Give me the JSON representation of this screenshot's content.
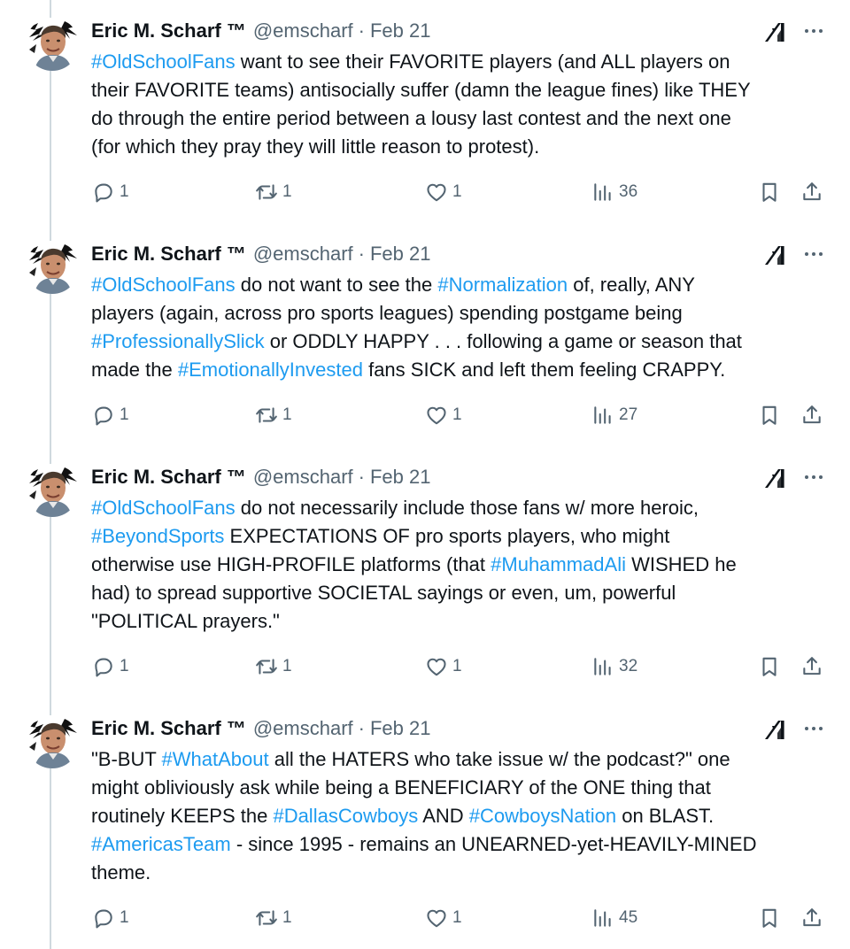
{
  "colors": {
    "text": "#0f1419",
    "muted": "#536471",
    "hashtag": "#1d9bf0",
    "thread_line": "#cfd9de"
  },
  "icons": [
    "avatar",
    "grok-icon",
    "more-icon",
    "reply-icon",
    "repost-icon",
    "like-icon",
    "views-icon",
    "bookmark-icon",
    "share-icon"
  ],
  "tweets": [
    {
      "author": {
        "name": "Eric M. Scharf ™",
        "handle": "@emscharf",
        "separator": "·",
        "date": "Feb 21"
      },
      "lines": [
        [
          {
            "t": "#OldSchoolFans",
            "h": true
          },
          {
            "t": " want to see their FAVORITE players (and ALL players on",
            "h": false
          }
        ],
        [
          {
            "t": "their FAVORITE teams) antisocially suffer (damn the league fines) like THEY",
            "h": false
          }
        ],
        [
          {
            "t": "do through the entire period between a lousy last contest and the next one",
            "h": false
          }
        ],
        [
          {
            "t": "(for which they pray they will little reason to protest).",
            "h": false
          }
        ]
      ],
      "stats": {
        "replies": "1",
        "reposts": "1",
        "likes": "1",
        "views": "36"
      }
    },
    {
      "author": {
        "name": "Eric M. Scharf ™",
        "handle": "@emscharf",
        "separator": "·",
        "date": "Feb 21"
      },
      "lines": [
        [
          {
            "t": "#OldSchoolFans",
            "h": true
          },
          {
            "t": " do not want to see the ",
            "h": false
          },
          {
            "t": "#Normalization",
            "h": true
          },
          {
            "t": " of, really, ANY",
            "h": false
          }
        ],
        [
          {
            "t": "players (again, across pro sports leagues) spending postgame being",
            "h": false
          }
        ],
        [
          {
            "t": "#ProfessionallySlick",
            "h": true
          },
          {
            "t": " or ODDLY HAPPY . . . following a game or season that",
            "h": false
          }
        ],
        [
          {
            "t": "made the ",
            "h": false
          },
          {
            "t": "#EmotionallyInvested",
            "h": true
          },
          {
            "t": " fans SICK and left them feeling CRAPPY.",
            "h": false
          }
        ]
      ],
      "stats": {
        "replies": "1",
        "reposts": "1",
        "likes": "1",
        "views": "27"
      }
    },
    {
      "author": {
        "name": "Eric M. Scharf ™",
        "handle": "@emscharf",
        "separator": "·",
        "date": "Feb 21"
      },
      "lines": [
        [
          {
            "t": "#OldSchoolFans",
            "h": true
          },
          {
            "t": " do not necessarily include those fans w/ more heroic,",
            "h": false
          }
        ],
        [
          {
            "t": "#BeyondSports",
            "h": true
          },
          {
            "t": " EXPECTATIONS OF pro sports players, who might",
            "h": false
          }
        ],
        [
          {
            "t": "otherwise use HIGH-PROFILE platforms (that ",
            "h": false
          },
          {
            "t": "#MuhammadAli",
            "h": true
          },
          {
            "t": " WISHED he",
            "h": false
          }
        ],
        [
          {
            "t": "had) to spread supportive SOCIETAL sayings or even, um, powerful",
            "h": false
          }
        ],
        [
          {
            "t": "\"POLITICAL prayers.\"",
            "h": false
          }
        ]
      ],
      "stats": {
        "replies": "1",
        "reposts": "1",
        "likes": "1",
        "views": "32"
      }
    },
    {
      "author": {
        "name": "Eric M. Scharf ™",
        "handle": "@emscharf",
        "separator": "·",
        "date": "Feb 21"
      },
      "lines": [
        [
          {
            "t": "\"B-BUT ",
            "h": false
          },
          {
            "t": "#WhatAbout",
            "h": true
          },
          {
            "t": " all the HATERS who take issue w/ the podcast?\" one",
            "h": false
          }
        ],
        [
          {
            "t": "might obliviously ask while being a BENEFICIARY of the ONE thing that",
            "h": false
          }
        ],
        [
          {
            "t": "routinely KEEPS the ",
            "h": false
          },
          {
            "t": "#DallasCowboys",
            "h": true
          },
          {
            "t": " AND ",
            "h": false
          },
          {
            "t": "#CowboysNation",
            "h": true
          },
          {
            "t": " on BLAST.",
            "h": false
          }
        ],
        [
          {
            "t": "#AmericasTeam",
            "h": true
          },
          {
            "t": " - since 1995 - remains an UNEARNED-yet-HEAVILY-MINED",
            "h": false
          }
        ],
        [
          {
            "t": "theme.",
            "h": false
          }
        ]
      ],
      "stats": {
        "replies": "1",
        "reposts": "1",
        "likes": "1",
        "views": "45"
      }
    }
  ]
}
